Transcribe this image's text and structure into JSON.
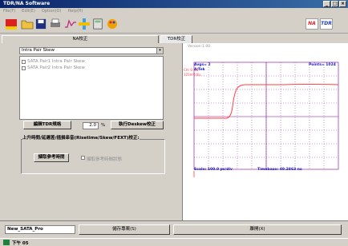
{
  "window": {
    "title": "TDR/NA Software",
    "controls": [
      "_",
      "□",
      "×"
    ]
  },
  "menu": {
    "items": [
      "File(F)",
      "Edit(E)",
      "Option(O)",
      "Help(H)"
    ]
  },
  "toolbar": {
    "na_label": "NA",
    "tdr_label": "TDR"
  },
  "tabs": {
    "left": "NA校正",
    "right": "TDR校正"
  },
  "left": {
    "select_value": "Intra Pair Skew",
    "list": [
      "SATA Pair1 Intra Pair Skew",
      "SATA Pair2 Intra Pair Skew"
    ],
    "edit_tdr_label": "編輯TDR規格",
    "skew_value": "2.0",
    "percent": "%",
    "deskew_button": "執行Deskew校正",
    "section_title": "上升時間/延遲差/插損串音(Risetime/Skew/FEXT)校正:",
    "ref_time_button": "擷取參考時間",
    "ref_time_check": "擷取參考時間狀態"
  },
  "scope": {
    "version": "Version:1.00",
    "avgs": "Avgs= 2",
    "points": "Points= 1024",
    "units": "Δ/Tek",
    "ch_label": "CH: 0 mV",
    "ch_scale": "125mV/div",
    "scale": "Scale: 100.0 ps/div",
    "timebase": "Timebase: 49.2863 ns"
  },
  "bottom": {
    "filename": "New_SATA_Pro",
    "save_button": "儲存專案(S)",
    "exit_button": "離開(X)"
  },
  "taskbar": {
    "time": "下午 05"
  },
  "colors": {
    "waveform": "#ff4040",
    "grid": "#8000a0",
    "scope_text": "#2020c0"
  }
}
